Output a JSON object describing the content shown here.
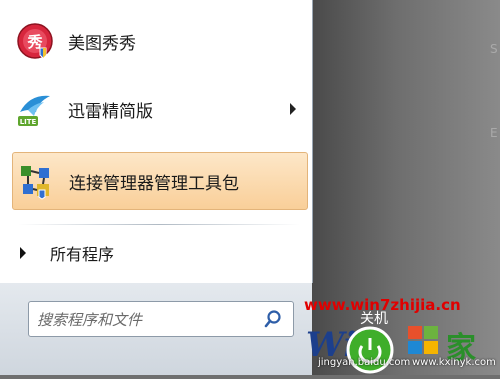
{
  "programs": [
    {
      "label": "美图秀秀",
      "icon": "meitu-xiuxiu-icon",
      "has_submenu": false
    },
    {
      "label": "迅雷精简版",
      "icon": "xunlei-lite-icon",
      "has_submenu": true
    },
    {
      "label": "连接管理器管理工具包",
      "icon": "connection-manager-kit-icon",
      "has_submenu": false,
      "highlighted": true
    }
  ],
  "all_programs_label": "所有程序",
  "search": {
    "placeholder": "搜索程序和文件"
  },
  "shutdown_label": "关机",
  "watermark": {
    "url": "www.win7zhijia.cn",
    "small_left": "jingyan.baidu.com",
    "small_right": "www.kxinyk.com"
  },
  "colors": {
    "highlight": "#f9cf99",
    "watermark_red": "#e00000"
  }
}
